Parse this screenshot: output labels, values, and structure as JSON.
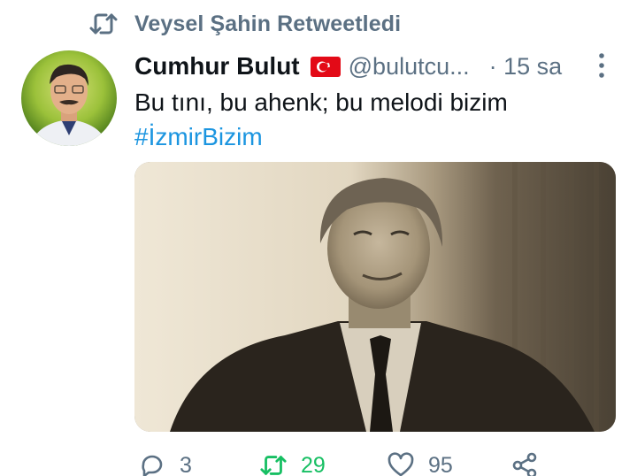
{
  "social_context": {
    "text": "Veysel Şahin Retweetledi",
    "icon": "retweet-icon"
  },
  "tweet": {
    "author_name": "Cumhur Bulut",
    "flag": "turkey-flag-icon",
    "handle": "@bulutcu...",
    "time": "· 15 sa",
    "text": "Bu tını, bu ahenk; bu melodi bizim",
    "hashtag": "#İzmirBizim"
  },
  "actions": {
    "reply_count": "3",
    "retweet_count": "29",
    "like_count": "95"
  },
  "colors": {
    "secondary_text": "#5b7083",
    "hashtag": "#1b95e0",
    "retweeted": "#17bf63",
    "primary_text": "#0f1419"
  }
}
